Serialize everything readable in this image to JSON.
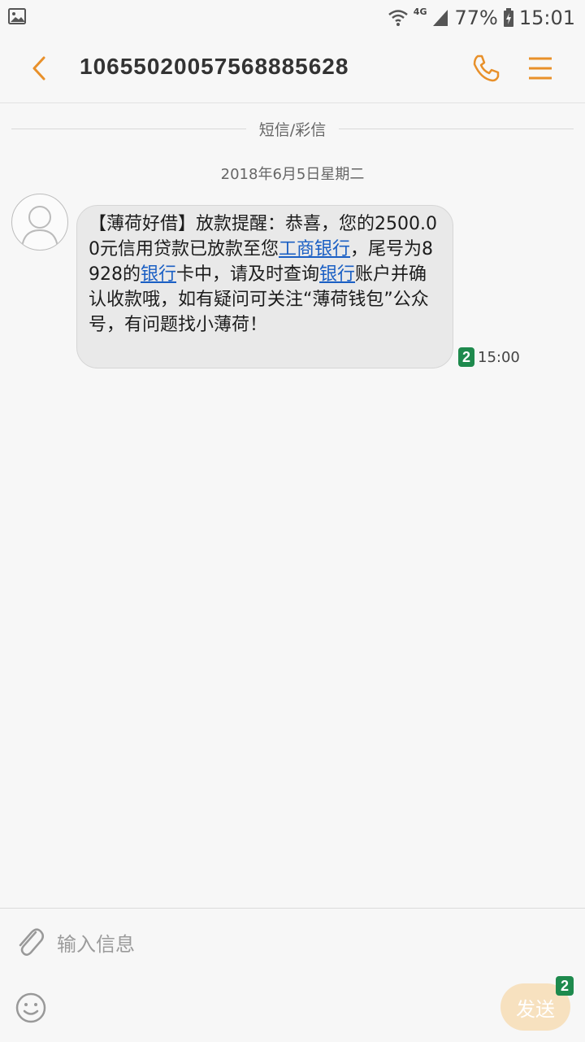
{
  "status_bar": {
    "network": "4G",
    "battery": "77%",
    "time": "15:01"
  },
  "header": {
    "title": "10655020057568885628"
  },
  "conversation": {
    "section_label": "短信/彩信",
    "date_label": "2018年6月5日星期二",
    "message": {
      "text_parts": [
        "【薄荷好借】放款提醒：恭喜，您的2500.00元信用贷款已放款至您",
        "工商银行",
        "，尾号为8928的",
        "银行",
        "卡中，请及时查询",
        "银行",
        "账户并确认收款哦，如有疑问可关注“薄荷钱包”公众号，有问题找小薄荷！"
      ],
      "sim": "2",
      "time": "15:00"
    }
  },
  "composer": {
    "placeholder": "输入信息",
    "send_label": "发送",
    "send_sim": "2"
  },
  "colors": {
    "accent": "#e8902a",
    "link": "#1a5fc4",
    "sim_badge": "#1e8a4d",
    "send_button": "#f7e1bf"
  }
}
